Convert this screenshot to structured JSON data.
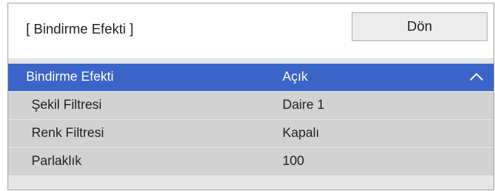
{
  "window": {
    "title": "[ Bindirme Efekti ]",
    "back_label": "Dön"
  },
  "settings": {
    "items": [
      {
        "label": "Bindirme Efekti",
        "value": "Açık",
        "selected": true,
        "icon": "chevron-up-icon"
      },
      {
        "label": "Şekil Filtresi",
        "value": "Daire 1",
        "selected": false
      },
      {
        "label": "Renk Filtresi",
        "value": "Kapalı",
        "selected": false
      },
      {
        "label": "Parlaklık",
        "value": "100",
        "selected": false
      }
    ]
  },
  "colors": {
    "selected_row": "#3a64c8",
    "row": "#d2d2d2",
    "panel": "#e6e6e6"
  }
}
